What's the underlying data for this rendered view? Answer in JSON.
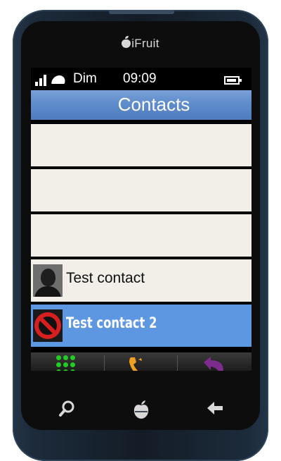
{
  "device": {
    "brand": "iFruit"
  },
  "status_bar": {
    "operator": "Dim",
    "time": "09:09",
    "signal_bars": 3,
    "battery_level": 0.9
  },
  "app": {
    "title": "Contacts"
  },
  "contacts": [
    {
      "name": "",
      "avatar": "none",
      "selected": false
    },
    {
      "name": "",
      "avatar": "none",
      "selected": false
    },
    {
      "name": "",
      "avatar": "none",
      "selected": false
    },
    {
      "name": "Test contact",
      "avatar": "silhouette-icon",
      "selected": false
    },
    {
      "name": "Test contact 2",
      "avatar": "blocked-icon",
      "selected": true
    }
  ],
  "action_bar": {
    "items": [
      {
        "icon": "keypad-icon",
        "color": "#22cc22"
      },
      {
        "icon": "phone-icon",
        "color": "#f0a020"
      },
      {
        "icon": "back-arrow-icon",
        "color": "#7b2c8c"
      }
    ]
  },
  "hardware_buttons": [
    {
      "icon": "search-icon"
    },
    {
      "icon": "home-fruit-icon"
    },
    {
      "icon": "back-icon"
    }
  ],
  "colors": {
    "accent": "#5d97e2",
    "row_background": "#f2efe9"
  }
}
